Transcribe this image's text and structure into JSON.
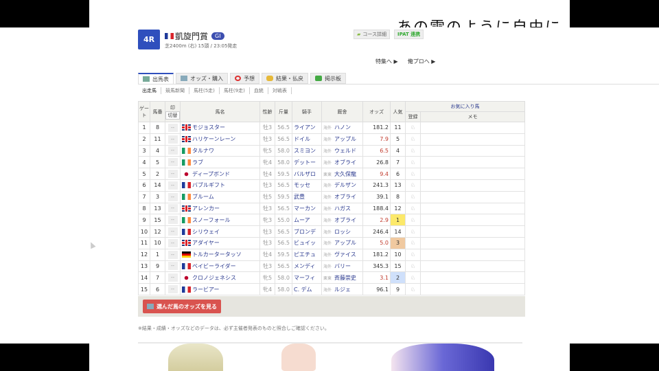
{
  "background": {
    "text": "あの雲のように自由に"
  },
  "race": {
    "number": "4R",
    "name": "凱旋門賞",
    "grade": "GI",
    "info": "芝2400m (右) 15頭 / 23:05発走"
  },
  "top_buttons": [
    "コース詳細",
    "IPAT 連携"
  ],
  "links": [
    "特集へ ▶",
    "俺プロへ ▶"
  ],
  "tabs": [
    "出馬表",
    "オッズ・購入",
    "予想",
    "結果・払戻",
    "掲示板"
  ],
  "subtabs": [
    "出走馬",
    "競馬新聞",
    "馬柱(5走)",
    "馬柱(9走)",
    "血統",
    "対戦表"
  ],
  "headers": {
    "gate": "ゲート",
    "num": "馬番",
    "mark": "印",
    "mark_toggle": "切替",
    "name": "馬名",
    "sexage": "性齢",
    "weight": "斤量",
    "jockey": "騎手",
    "trainer": "厩舎",
    "odds": "オッズ",
    "pop": "人気",
    "fav": "お気に入り馬",
    "register": "登録",
    "memo": "メモ"
  },
  "rows": [
    {
      "gate": "1",
      "num": "8",
      "flag": "gb",
      "name": "モジョスター",
      "sexage": "牡3",
      "weight": "56.5",
      "jockey": "ライアン",
      "region": "海外",
      "trainer": "ハノン",
      "odds": "181.2",
      "pop": "11"
    },
    {
      "gate": "2",
      "num": "11",
      "flag": "gb",
      "name": "ハリケーンレーン",
      "sexage": "牡3",
      "weight": "56.5",
      "jockey": "ドイル",
      "region": "海外",
      "trainer": "アップル",
      "odds": "7.9",
      "pop": "5",
      "hot": true
    },
    {
      "gate": "3",
      "num": "4",
      "flag": "ie",
      "name": "タルナワ",
      "sexage": "牝5",
      "weight": "58.0",
      "jockey": "スミヨン",
      "region": "海外",
      "trainer": "ウェルド",
      "odds": "6.5",
      "pop": "4",
      "hot": true
    },
    {
      "gate": "4",
      "num": "5",
      "flag": "ie",
      "name": "ラブ",
      "sexage": "牝4",
      "weight": "58.0",
      "jockey": "デットー",
      "region": "海外",
      "trainer": "オブライ",
      "odds": "26.8",
      "pop": "7"
    },
    {
      "gate": "5",
      "num": "2",
      "flag": "jp",
      "name": "ディープボンド",
      "sexage": "牡4",
      "weight": "59.5",
      "jockey": "バルザロ",
      "region": "栗東",
      "trainer": "大久保龍",
      "odds": "9.4",
      "pop": "6",
      "hot": true
    },
    {
      "gate": "6",
      "num": "14",
      "flag": "fr",
      "name": "バブルギフト",
      "sexage": "牡3",
      "weight": "56.5",
      "jockey": "モッセ",
      "region": "海外",
      "trainer": "デルザン",
      "odds": "241.3",
      "pop": "13"
    },
    {
      "gate": "7",
      "num": "3",
      "flag": "ie",
      "name": "ブルーム",
      "sexage": "牡5",
      "weight": "59.5",
      "jockey": "武豊",
      "region": "海外",
      "trainer": "オブライ",
      "odds": "39.1",
      "pop": "8"
    },
    {
      "gate": "8",
      "num": "13",
      "flag": "gb",
      "name": "アレンカー",
      "sexage": "牡3",
      "weight": "56.5",
      "jockey": "マーカン",
      "region": "海外",
      "trainer": "ハガス",
      "odds": "188.4",
      "pop": "12"
    },
    {
      "gate": "9",
      "num": "15",
      "flag": "ie",
      "name": "スノーフォール",
      "sexage": "牝3",
      "weight": "55.0",
      "jockey": "ムーア",
      "region": "海外",
      "trainer": "オブライ",
      "odds": "2.9",
      "pop": "1",
      "hot": true,
      "rank": 1
    },
    {
      "gate": "10",
      "num": "12",
      "flag": "fr",
      "name": "シリウェイ",
      "sexage": "牡3",
      "weight": "56.5",
      "jockey": "ブロンデ",
      "region": "海外",
      "trainer": "ロッシ",
      "odds": "246.4",
      "pop": "14"
    },
    {
      "gate": "11",
      "num": "10",
      "flag": "gb",
      "name": "アダイヤー",
      "sexage": "牡3",
      "weight": "56.5",
      "jockey": "ビュイッ",
      "region": "海外",
      "trainer": "アップル",
      "odds": "5.0",
      "pop": "3",
      "hot": true,
      "rank": 3
    },
    {
      "gate": "12",
      "num": "1",
      "flag": "de",
      "name": "トルカータータッソ",
      "sexage": "牡4",
      "weight": "59.5",
      "jockey": "ピエチュ",
      "region": "海外",
      "trainer": "ヴァイス",
      "odds": "181.2",
      "pop": "10"
    },
    {
      "gate": "13",
      "num": "9",
      "flag": "fr",
      "name": "ベイビーライダー",
      "sexage": "牡3",
      "weight": "56.5",
      "jockey": "メンディ",
      "region": "海外",
      "trainer": "バリー",
      "odds": "345.3",
      "pop": "15"
    },
    {
      "gate": "14",
      "num": "7",
      "flag": "jp",
      "name": "クロノジェネシス",
      "sexage": "牝5",
      "weight": "58.0",
      "jockey": "マーフィ",
      "region": "栗東",
      "trainer": "斉藤崇史",
      "odds": "3.1",
      "pop": "2",
      "hot": true,
      "rank": 2
    },
    {
      "gate": "15",
      "num": "6",
      "flag": "fr",
      "name": "ラービアー",
      "sexage": "牝4",
      "weight": "58.0",
      "jockey": "C. デム",
      "region": "海外",
      "trainer": "ルジェ",
      "odds": "96.1",
      "pop": "9"
    }
  ],
  "mark_placeholder": "--",
  "odds_button": "選んだ馬のオッズを見る",
  "note": "※結果・成績・オッズなどのデータは、必ず主催者発表のものと照合しご確認ください。"
}
